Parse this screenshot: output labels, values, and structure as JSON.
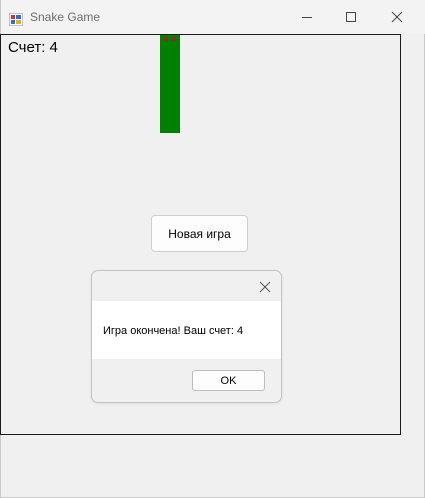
{
  "window": {
    "title": "Snake Game"
  },
  "game": {
    "score_text": "Счет: 4",
    "snake_color": "#008000",
    "new_game_label": "Новая игра"
  },
  "dialog": {
    "message": "Игра окончена! Ваш счет: 4",
    "ok_label": "OK"
  },
  "icons": {
    "app": "app-icon",
    "minimize": "minimize-icon",
    "maximize": "maximize-icon",
    "close": "close-icon",
    "dialog_close": "close-icon"
  }
}
